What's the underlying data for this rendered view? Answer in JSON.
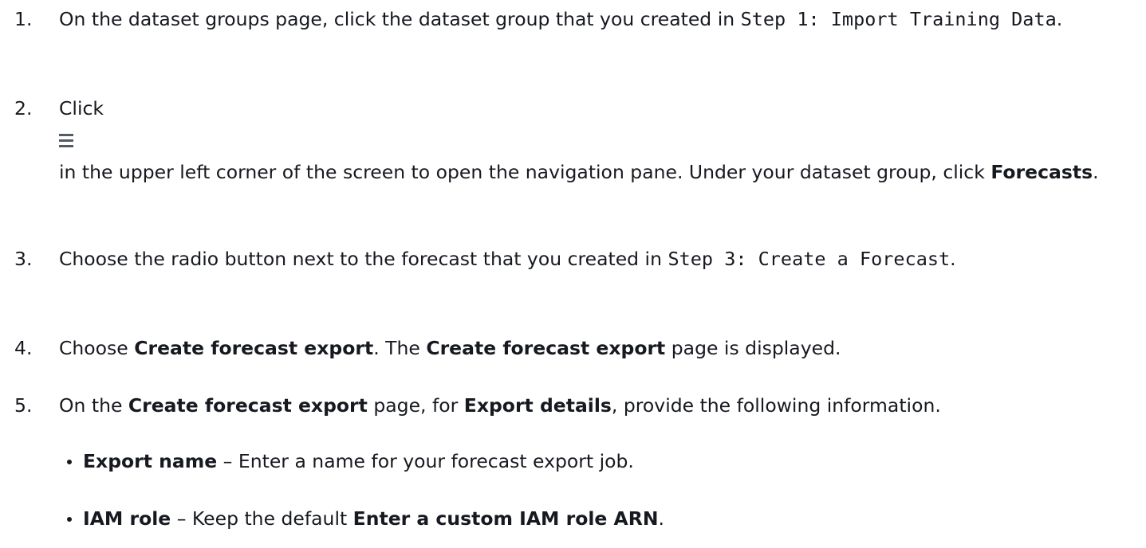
{
  "steps": [
    {
      "number": "1.",
      "text_1": "On the dataset groups page, click the dataset group that you created in ",
      "code_1": "Step 1: Import Training Data",
      "text_2": "."
    },
    {
      "number": "2.",
      "text_1": "Click",
      "icon": "menu-icon",
      "text_2": "in the upper left corner of the screen to open the navigation pane. Under your dataset group, click ",
      "bold_1": "Forecasts",
      "text_3": "."
    },
    {
      "number": "3.",
      "text_1": "Choose the radio button next to the forecast that you created in ",
      "code_1": "Step 3: Create a Forecast",
      "text_2": "."
    },
    {
      "number": "4.",
      "text_1": "Choose ",
      "bold_1": "Create forecast export",
      "text_2": ". The ",
      "bold_2": "Create forecast export",
      "text_3": " page is displayed."
    },
    {
      "number": "5.",
      "text_1": "On the ",
      "bold_1": "Create forecast export",
      "text_2": " page, for ",
      "bold_2": "Export details",
      "text_3": ", provide the following information.",
      "bullets": [
        {
          "bold": "Export name",
          "text": " – Enter a name for your forecast export job."
        },
        {
          "bold": "IAM role",
          "text": " – Keep the default ",
          "bold_2": "Enter a custom IAM role ARN",
          "text_2": "."
        }
      ]
    }
  ]
}
